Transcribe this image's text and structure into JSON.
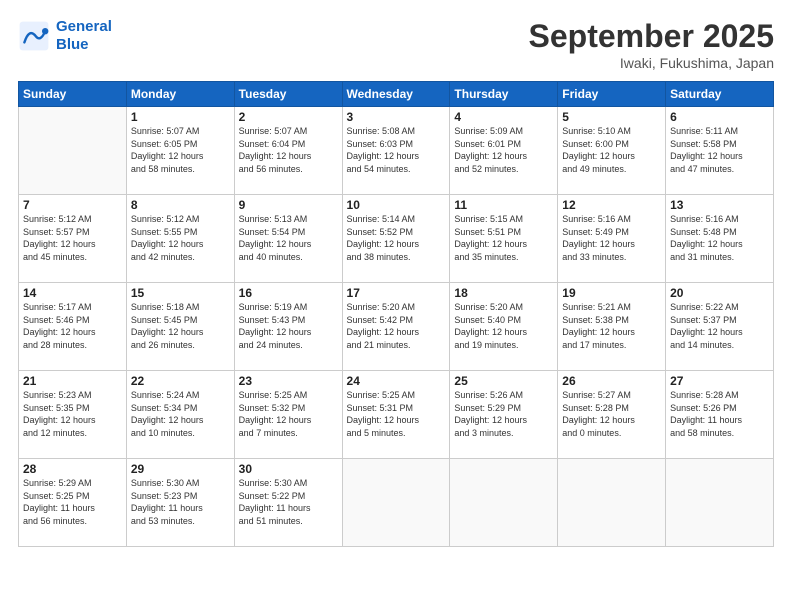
{
  "header": {
    "logo_line1": "General",
    "logo_line2": "Blue",
    "month": "September 2025",
    "location": "Iwaki, Fukushima, Japan"
  },
  "weekdays": [
    "Sunday",
    "Monday",
    "Tuesday",
    "Wednesday",
    "Thursday",
    "Friday",
    "Saturday"
  ],
  "weeks": [
    [
      {
        "day": "",
        "info": ""
      },
      {
        "day": "1",
        "info": "Sunrise: 5:07 AM\nSunset: 6:05 PM\nDaylight: 12 hours\nand 58 minutes."
      },
      {
        "day": "2",
        "info": "Sunrise: 5:07 AM\nSunset: 6:04 PM\nDaylight: 12 hours\nand 56 minutes."
      },
      {
        "day": "3",
        "info": "Sunrise: 5:08 AM\nSunset: 6:03 PM\nDaylight: 12 hours\nand 54 minutes."
      },
      {
        "day": "4",
        "info": "Sunrise: 5:09 AM\nSunset: 6:01 PM\nDaylight: 12 hours\nand 52 minutes."
      },
      {
        "day": "5",
        "info": "Sunrise: 5:10 AM\nSunset: 6:00 PM\nDaylight: 12 hours\nand 49 minutes."
      },
      {
        "day": "6",
        "info": "Sunrise: 5:11 AM\nSunset: 5:58 PM\nDaylight: 12 hours\nand 47 minutes."
      }
    ],
    [
      {
        "day": "7",
        "info": "Sunrise: 5:12 AM\nSunset: 5:57 PM\nDaylight: 12 hours\nand 45 minutes."
      },
      {
        "day": "8",
        "info": "Sunrise: 5:12 AM\nSunset: 5:55 PM\nDaylight: 12 hours\nand 42 minutes."
      },
      {
        "day": "9",
        "info": "Sunrise: 5:13 AM\nSunset: 5:54 PM\nDaylight: 12 hours\nand 40 minutes."
      },
      {
        "day": "10",
        "info": "Sunrise: 5:14 AM\nSunset: 5:52 PM\nDaylight: 12 hours\nand 38 minutes."
      },
      {
        "day": "11",
        "info": "Sunrise: 5:15 AM\nSunset: 5:51 PM\nDaylight: 12 hours\nand 35 minutes."
      },
      {
        "day": "12",
        "info": "Sunrise: 5:16 AM\nSunset: 5:49 PM\nDaylight: 12 hours\nand 33 minutes."
      },
      {
        "day": "13",
        "info": "Sunrise: 5:16 AM\nSunset: 5:48 PM\nDaylight: 12 hours\nand 31 minutes."
      }
    ],
    [
      {
        "day": "14",
        "info": "Sunrise: 5:17 AM\nSunset: 5:46 PM\nDaylight: 12 hours\nand 28 minutes."
      },
      {
        "day": "15",
        "info": "Sunrise: 5:18 AM\nSunset: 5:45 PM\nDaylight: 12 hours\nand 26 minutes."
      },
      {
        "day": "16",
        "info": "Sunrise: 5:19 AM\nSunset: 5:43 PM\nDaylight: 12 hours\nand 24 minutes."
      },
      {
        "day": "17",
        "info": "Sunrise: 5:20 AM\nSunset: 5:42 PM\nDaylight: 12 hours\nand 21 minutes."
      },
      {
        "day": "18",
        "info": "Sunrise: 5:20 AM\nSunset: 5:40 PM\nDaylight: 12 hours\nand 19 minutes."
      },
      {
        "day": "19",
        "info": "Sunrise: 5:21 AM\nSunset: 5:38 PM\nDaylight: 12 hours\nand 17 minutes."
      },
      {
        "day": "20",
        "info": "Sunrise: 5:22 AM\nSunset: 5:37 PM\nDaylight: 12 hours\nand 14 minutes."
      }
    ],
    [
      {
        "day": "21",
        "info": "Sunrise: 5:23 AM\nSunset: 5:35 PM\nDaylight: 12 hours\nand 12 minutes."
      },
      {
        "day": "22",
        "info": "Sunrise: 5:24 AM\nSunset: 5:34 PM\nDaylight: 12 hours\nand 10 minutes."
      },
      {
        "day": "23",
        "info": "Sunrise: 5:25 AM\nSunset: 5:32 PM\nDaylight: 12 hours\nand 7 minutes."
      },
      {
        "day": "24",
        "info": "Sunrise: 5:25 AM\nSunset: 5:31 PM\nDaylight: 12 hours\nand 5 minutes."
      },
      {
        "day": "25",
        "info": "Sunrise: 5:26 AM\nSunset: 5:29 PM\nDaylight: 12 hours\nand 3 minutes."
      },
      {
        "day": "26",
        "info": "Sunrise: 5:27 AM\nSunset: 5:28 PM\nDaylight: 12 hours\nand 0 minutes."
      },
      {
        "day": "27",
        "info": "Sunrise: 5:28 AM\nSunset: 5:26 PM\nDaylight: 11 hours\nand 58 minutes."
      }
    ],
    [
      {
        "day": "28",
        "info": "Sunrise: 5:29 AM\nSunset: 5:25 PM\nDaylight: 11 hours\nand 56 minutes."
      },
      {
        "day": "29",
        "info": "Sunrise: 5:30 AM\nSunset: 5:23 PM\nDaylight: 11 hours\nand 53 minutes."
      },
      {
        "day": "30",
        "info": "Sunrise: 5:30 AM\nSunset: 5:22 PM\nDaylight: 11 hours\nand 51 minutes."
      },
      {
        "day": "",
        "info": ""
      },
      {
        "day": "",
        "info": ""
      },
      {
        "day": "",
        "info": ""
      },
      {
        "day": "",
        "info": ""
      }
    ]
  ]
}
